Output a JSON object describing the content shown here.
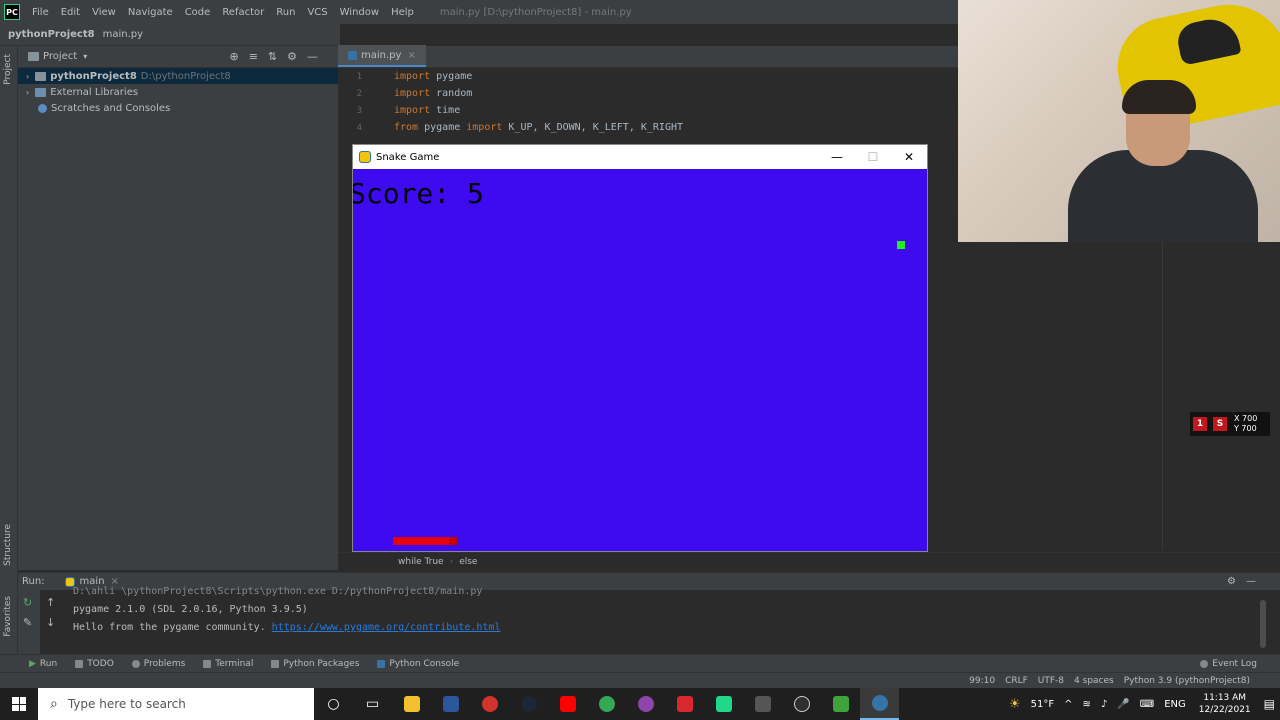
{
  "ide": {
    "menu": [
      "File",
      "Edit",
      "View",
      "Navigate",
      "Code",
      "Refactor",
      "Run",
      "VCS",
      "Window",
      "Help"
    ],
    "window_title": "main.py [D:\\pythonProject8] - main.py",
    "nav_project": "pythonProject8",
    "nav_file": "main.py",
    "project_panel": {
      "title": "Project",
      "tree": [
        {
          "label": "pythonProject8",
          "detail": "D:\\pythonProject8"
        },
        {
          "label": "External Libraries",
          "detail": ""
        },
        {
          "label": "Scratches and Consoles",
          "detail": ""
        }
      ]
    },
    "left_stripe": {
      "project": "Project",
      "structure": "Structure",
      "favorites": "Favorites"
    },
    "editor_tab": "main.py",
    "code_lines": [
      {
        "num": "1",
        "kw": "import",
        "rest": " pygame"
      },
      {
        "num": "2",
        "kw": "import",
        "rest": " random"
      },
      {
        "num": "3",
        "kw": "import",
        "rest": " time"
      },
      {
        "num": "4",
        "kw": "from",
        "rest": " pygame ",
        "kw2": "import",
        "rest2": " K_UP, K_DOWN, K_LEFT, K_RIGHT"
      }
    ],
    "breadcrumb": [
      "while True",
      "else"
    ],
    "run": {
      "label": "Run:",
      "config": "main",
      "output": [
        "D:\\ahli \\pythonProject8\\Scripts\\python.exe D:/pythonProject8/main.py",
        "pygame 2.1.0 (SDL 2.0.16, Python 3.9.5)",
        "Hello from the pygame community. "
      ],
      "link": "https://www.pygame.org/contribute.html"
    },
    "bottom_tabs": [
      "Run",
      "TODO",
      "Problems",
      "Terminal",
      "Python Packages",
      "Python Console"
    ],
    "event_log": "Event Log",
    "status": [
      "99:10",
      "CRLF",
      "UTF-8",
      "4 spaces",
      "Python 3.9 (pythonProject8)"
    ]
  },
  "snake_window": {
    "title": "Snake Game",
    "score_text": "Score: 5",
    "colors": {
      "background": "#3e0bf0",
      "food": "#22ee22",
      "snake": "#e8000a"
    }
  },
  "overlay": {
    "x_label": "X 700",
    "y_label": "Y 700"
  },
  "taskbar": {
    "search_placeholder": "Type here to search",
    "weather": "51°F",
    "lang": "ENG",
    "time": "11:13 AM",
    "date": "12/22/2021"
  }
}
